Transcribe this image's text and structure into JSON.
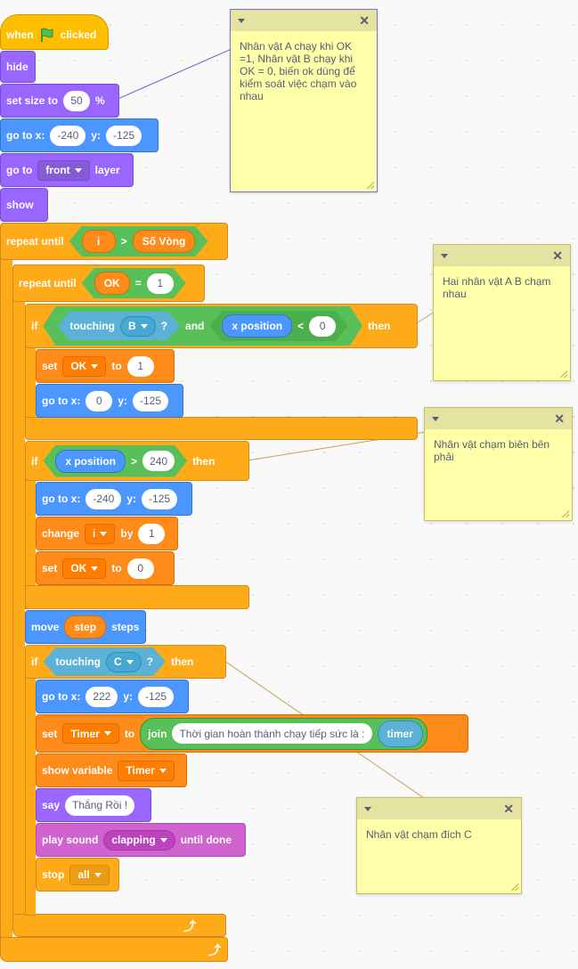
{
  "hat": {
    "prefix": "when",
    "suffix": "clicked",
    "flag_icon": "green-flag-icon"
  },
  "b_hide": {
    "label": "hide"
  },
  "b_size": {
    "label": "set size to",
    "value": "50",
    "unit": "%"
  },
  "b_goto1": {
    "label": "go to x:",
    "x": "-240",
    "ylabel": "y:",
    "y": "-125"
  },
  "b_layer": {
    "label": "go to",
    "option": "front",
    "suffix": "layer"
  },
  "b_show": {
    "label": "show"
  },
  "loop1": {
    "label": "repeat until",
    "var": "i",
    "op": ">",
    "var2": "Số Vòng"
  },
  "loop2": {
    "label": "repeat until",
    "var": "OK",
    "op": "=",
    "value": "1"
  },
  "if1": {
    "label": "if",
    "touching": "touching",
    "target": "B",
    "q": "?",
    "and": "and",
    "xpos": "x position",
    "op": "<",
    "value": "0",
    "then": "then"
  },
  "set1": {
    "label": "set",
    "var": "OK",
    "to": "to",
    "value": "1"
  },
  "goto2": {
    "label": "go to x:",
    "x": "0",
    "ylabel": "y:",
    "y": "-125"
  },
  "if2": {
    "label": "if",
    "xpos": "x position",
    "op": ">",
    "value": "240",
    "then": "then"
  },
  "goto3": {
    "label": "go to x:",
    "x": "-240",
    "ylabel": "y:",
    "y": "-125"
  },
  "change1": {
    "label": "change",
    "var": "i",
    "by": "by",
    "value": "1"
  },
  "set2": {
    "label": "set",
    "var": "OK",
    "to": "to",
    "value": "0"
  },
  "move1": {
    "label": "move",
    "var": "step",
    "suffix": "steps"
  },
  "if3": {
    "label": "if",
    "touching": "touching",
    "target": "C",
    "q": "?",
    "then": "then"
  },
  "goto4": {
    "label": "go to x:",
    "x": "222",
    "ylabel": "y:",
    "y": "-125"
  },
  "set3": {
    "label": "set",
    "var": "Timer",
    "to": "to",
    "join": "join",
    "text": "Thời gian hoàn thành chạy tiếp sức là :",
    "var2": "timer"
  },
  "showvar": {
    "label": "show variable",
    "var": "Timer"
  },
  "say1": {
    "label": "say",
    "text": "Thắng Rồi !"
  },
  "sound1": {
    "label": "play sound",
    "sound": "clapping",
    "suffix": "until done"
  },
  "stop1": {
    "label": "stop",
    "option": "all"
  },
  "notes": [
    {
      "text": "Nhân vật A chạy khi OK =1, Nhân vật B chạy khi OK = 0, biến ok dùng để kiểm soát việc chạm vào nhau"
    },
    {
      "text": "Hai nhân vật A B chạm nhau"
    },
    {
      "text": "Nhân vật chạm biên bên phải"
    },
    {
      "text": "Nhân vật chạm đích C"
    }
  ],
  "icons": {
    "turn": "loop-arrow-icon",
    "note_toggle": "collapse-arrow-icon",
    "note_close": "close-icon"
  },
  "colors": {
    "events": "#ffbf00",
    "looks": "#9966ff",
    "motion": "#4c97ff",
    "control": "#ffab19",
    "variables": "#ff8c1a",
    "sound": "#cf63cf",
    "operators": "#59c059",
    "sensing": "#5cb1d6",
    "note": "#feffa8"
  }
}
